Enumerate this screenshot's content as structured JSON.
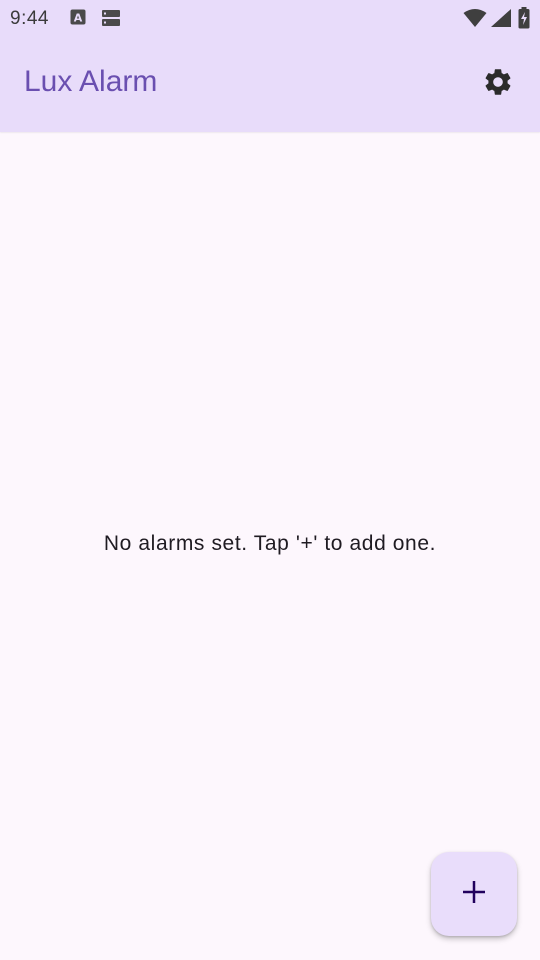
{
  "status_bar": {
    "time": "9:44",
    "icons": [
      "keyboard-a-icon",
      "sim-storage-icon",
      "wifi-icon",
      "signal-icon",
      "battery-charging-icon"
    ]
  },
  "app_bar": {
    "title": "Lux Alarm",
    "settings_icon": "gear-icon"
  },
  "main": {
    "empty_message": "No alarms set. Tap '+' to add one."
  },
  "fab": {
    "icon": "plus-icon"
  },
  "colors": {
    "app_bar_bg": "#e8dcfa",
    "title": "#6a4fb0",
    "background": "#fdf7fd",
    "fab_bg": "#e9ddfb",
    "fab_icon": "#21005d"
  }
}
